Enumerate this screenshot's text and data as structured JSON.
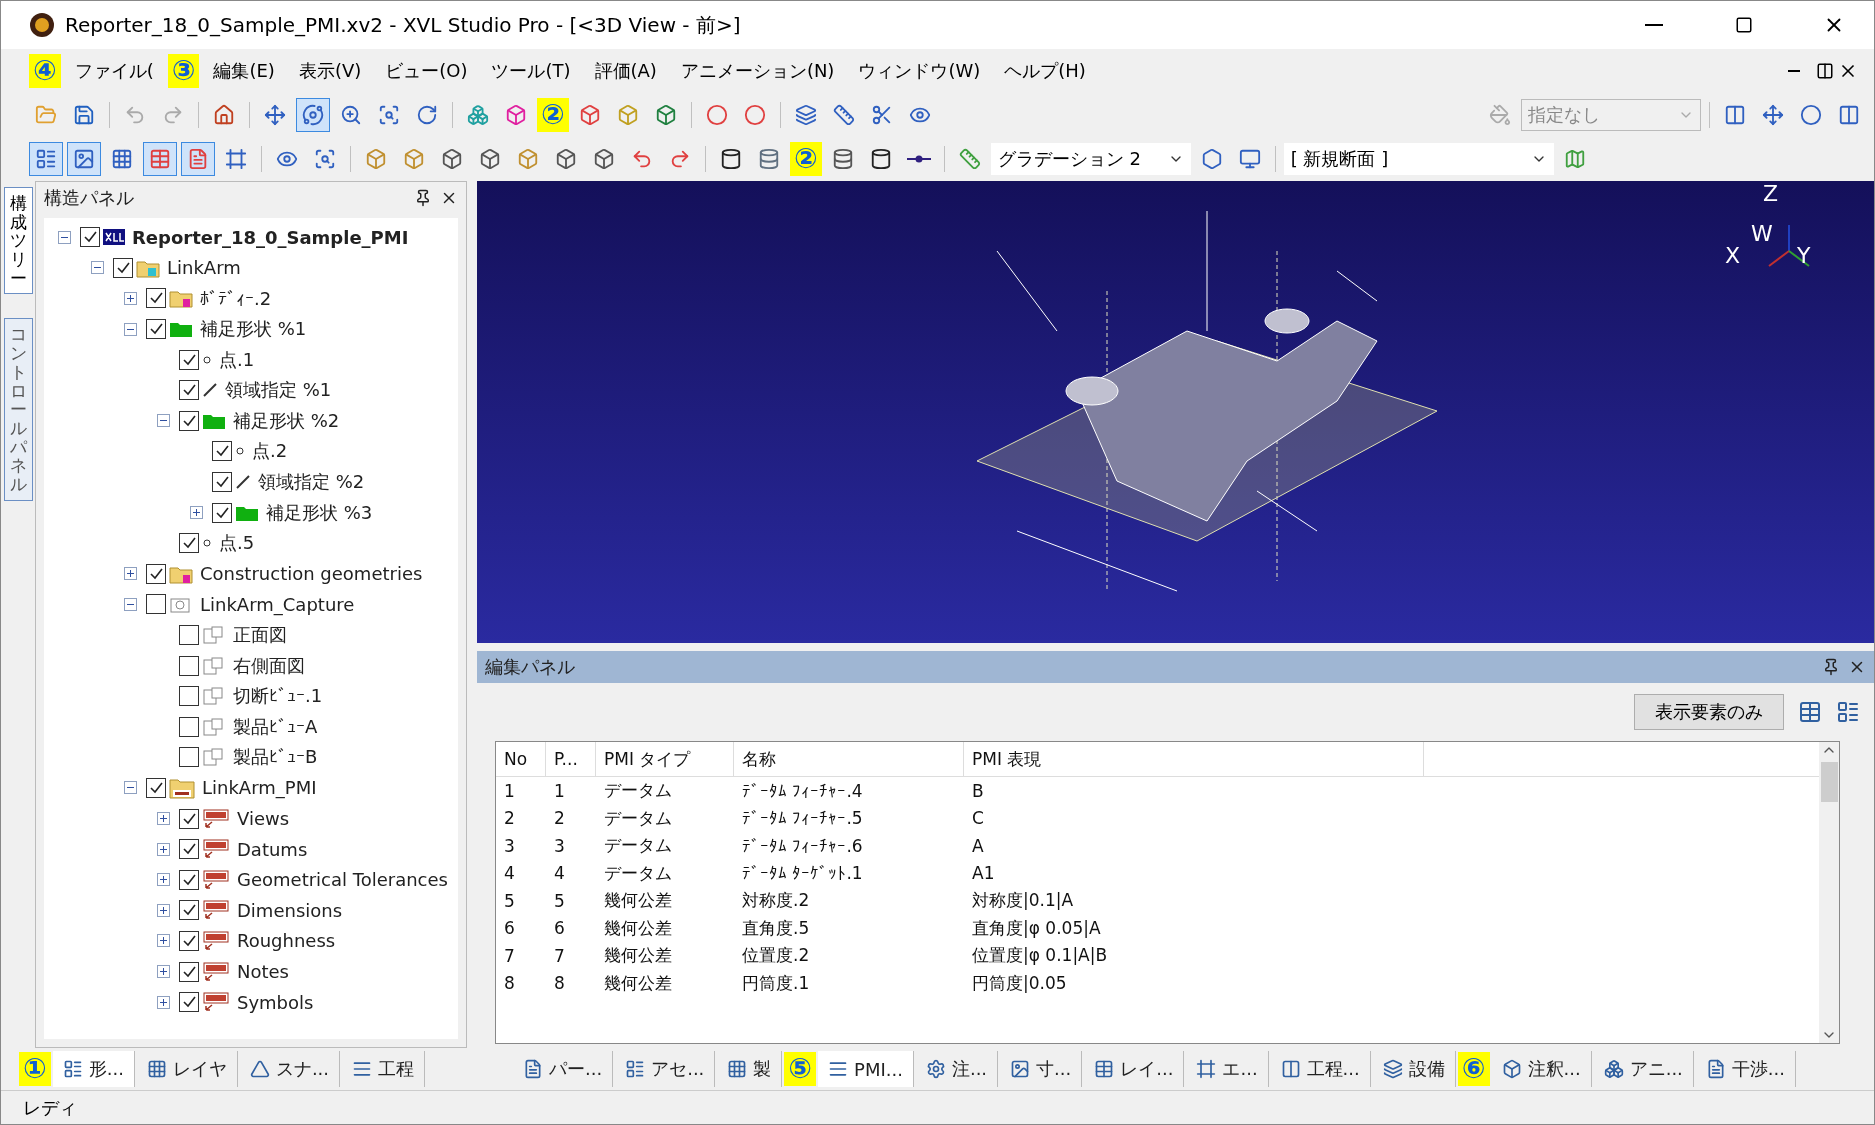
{
  "window": {
    "title": "Reporter_18_0_Sample_PMI.xv2 - XVL Studio Pro - [<3D View - 前>]"
  },
  "menu": [
    {
      "kind": "callout",
      "label": "④"
    },
    {
      "kind": "menu",
      "label": "ファイル("
    },
    {
      "kind": "callout",
      "label": "③"
    },
    {
      "kind": "menu",
      "label": "編集(E)"
    },
    {
      "kind": "menu",
      "label": "表示(V)"
    },
    {
      "kind": "menu",
      "label": "ビュー(O)"
    },
    {
      "kind": "menu",
      "label": "ツール(T)"
    },
    {
      "kind": "menu",
      "label": "評価(A)"
    },
    {
      "kind": "menu",
      "label": "アニメーション(N)"
    },
    {
      "kind": "menu",
      "label": "ウィンドウ(W)"
    },
    {
      "kind": "menu",
      "label": "ヘルプ(H)"
    }
  ],
  "toolbars": {
    "row1_callout": "②",
    "style_combo": {
      "value": "指定なし",
      "disabled": true
    },
    "row2_callout": "②",
    "gradient_combo": {
      "value": "グラデーション 2",
      "disabled": false
    },
    "section_combo": {
      "value": "[ 新規断面 ]",
      "disabled": false
    }
  },
  "side_tabs": [
    {
      "label": "構成ツリー",
      "selected": true
    },
    {
      "label": "コントロールパネル",
      "selected": false
    }
  ],
  "structure_panel": {
    "title": "構造パネル",
    "tree": [
      {
        "label": "Reporter_18_0_Sample_PMI",
        "kind": "xvl",
        "checked": true,
        "expanded": true,
        "children": [
          {
            "label": "LinkArm",
            "kind": "part-folder",
            "checked": true,
            "expanded": true,
            "children": [
              {
                "label": "ﾎﾞﾃﾞｨｰ.2",
                "kind": "tag-folder",
                "checked": true,
                "expanded": false
              },
              {
                "label": "補足形状 %1",
                "kind": "green-folder",
                "checked": true,
                "expanded": true,
                "children": [
                  {
                    "label": "点.1",
                    "kind": "point",
                    "checked": true
                  },
                  {
                    "label": "領域指定 %1",
                    "kind": "line",
                    "checked": true
                  },
                  {
                    "label": "補足形状 %2",
                    "kind": "green-folder",
                    "checked": true,
                    "expanded": true,
                    "children": [
                      {
                        "label": "点.2",
                        "kind": "point",
                        "checked": true
                      },
                      {
                        "label": "領域指定 %2",
                        "kind": "line",
                        "checked": true
                      },
                      {
                        "label": "補足形状 %3",
                        "kind": "green-folder",
                        "checked": true,
                        "expanded": false
                      }
                    ]
                  },
                  {
                    "label": "点.5",
                    "kind": "point",
                    "checked": true
                  }
                ]
              },
              {
                "label": "Construction geometries",
                "kind": "tag-folder",
                "checked": true,
                "expanded": false
              },
              {
                "label": "LinkArm_Capture",
                "kind": "capture",
                "checked": false,
                "expanded": true,
                "children": [
                  {
                    "label": "正面図",
                    "kind": "view",
                    "checked": false
                  },
                  {
                    "label": "右側面図",
                    "kind": "view",
                    "checked": false
                  },
                  {
                    "label": "切断ﾋﾞｭｰ.1",
                    "kind": "view",
                    "checked": false
                  },
                  {
                    "label": "製品ﾋﾞｭｰA",
                    "kind": "view",
                    "checked": false
                  },
                  {
                    "label": "製品ﾋﾞｭｰB",
                    "kind": "view",
                    "checked": false
                  }
                ]
              },
              {
                "label": "LinkArm_PMI",
                "kind": "pmi-folder",
                "checked": true,
                "expanded": true,
                "children": [
                  {
                    "label": "Views",
                    "kind": "pmi",
                    "checked": true,
                    "expanded": false
                  },
                  {
                    "label": "Datums",
                    "kind": "pmi",
                    "checked": true,
                    "expanded": false
                  },
                  {
                    "label": "Geometrical Tolerances",
                    "kind": "pmi",
                    "checked": true,
                    "expanded": false
                  },
                  {
                    "label": "Dimensions",
                    "kind": "pmi",
                    "checked": true,
                    "expanded": false
                  },
                  {
                    "label": "Roughness",
                    "kind": "pmi",
                    "checked": true,
                    "expanded": false
                  },
                  {
                    "label": "Notes",
                    "kind": "pmi",
                    "checked": true,
                    "expanded": false
                  },
                  {
                    "label": "Symbols",
                    "kind": "pmi",
                    "checked": true,
                    "expanded": false
                  }
                ]
              }
            ]
          }
        ]
      }
    ]
  },
  "view": {
    "axes": [
      "Z",
      "X",
      "W",
      "Y"
    ]
  },
  "edit_panel": {
    "title": "編集パネル",
    "button": "表示要素のみ",
    "columns": [
      "No",
      "P...",
      "PMI タイプ",
      "名称",
      "PMI 表現"
    ],
    "rows": [
      [
        "1",
        "1",
        "データム",
        "ﾃﾞｰﾀﾑ ﾌｨｰﾁｬｰ.4",
        "B"
      ],
      [
        "2",
        "2",
        "データム",
        "ﾃﾞｰﾀﾑ ﾌｨｰﾁｬｰ.5",
        "C"
      ],
      [
        "3",
        "3",
        "データム",
        "ﾃﾞｰﾀﾑ ﾌｨｰﾁｬｰ.6",
        "A"
      ],
      [
        "4",
        "4",
        "データム",
        "ﾃﾞｰﾀﾑ ﾀｰｹﾞｯﾄ.1",
        "A1"
      ],
      [
        "5",
        "5",
        "幾何公差",
        "対称度.2",
        "対称度|0.1|A"
      ],
      [
        "6",
        "6",
        "幾何公差",
        "直角度.5",
        "直角度|φ 0.05|A"
      ],
      [
        "7",
        "7",
        "幾何公差",
        "位置度.2",
        "位置度|φ 0.1|A|B"
      ],
      [
        "8",
        "8",
        "幾何公差",
        "円筒度.1",
        "円筒度|0.05"
      ]
    ]
  },
  "left_tabs": [
    {
      "kind": "callout",
      "label": "①"
    },
    {
      "kind": "tab",
      "label": "形...",
      "selected": true
    },
    {
      "kind": "tab",
      "label": "レイヤ",
      "selected": false
    },
    {
      "kind": "tab",
      "label": "スナ...",
      "selected": false
    },
    {
      "kind": "tab",
      "label": "工程",
      "selected": false
    }
  ],
  "right_tabs": [
    {
      "kind": "tab",
      "label": "パー...",
      "selected": false
    },
    {
      "kind": "tab",
      "label": "アセ...",
      "selected": false
    },
    {
      "kind": "tab",
      "label": "製",
      "selected": false
    },
    {
      "kind": "callout",
      "label": "⑤"
    },
    {
      "kind": "tab",
      "label": "PMI...",
      "selected": true
    },
    {
      "kind": "tab",
      "label": "注...",
      "selected": false
    },
    {
      "kind": "tab",
      "label": "寸...",
      "selected": false
    },
    {
      "kind": "tab",
      "label": "レイ...",
      "selected": false
    },
    {
      "kind": "tab",
      "label": "エ...",
      "selected": false
    },
    {
      "kind": "tab",
      "label": "工程...",
      "selected": false
    },
    {
      "kind": "tab",
      "label": "設備",
      "selected": false
    },
    {
      "kind": "callout",
      "label": "⑥"
    },
    {
      "kind": "tab",
      "label": "注釈...",
      "selected": false
    },
    {
      "kind": "tab",
      "label": "アニ...",
      "selected": false
    },
    {
      "kind": "tab",
      "label": "干渉...",
      "selected": false
    }
  ],
  "status_bar": {
    "text": "レディ"
  }
}
